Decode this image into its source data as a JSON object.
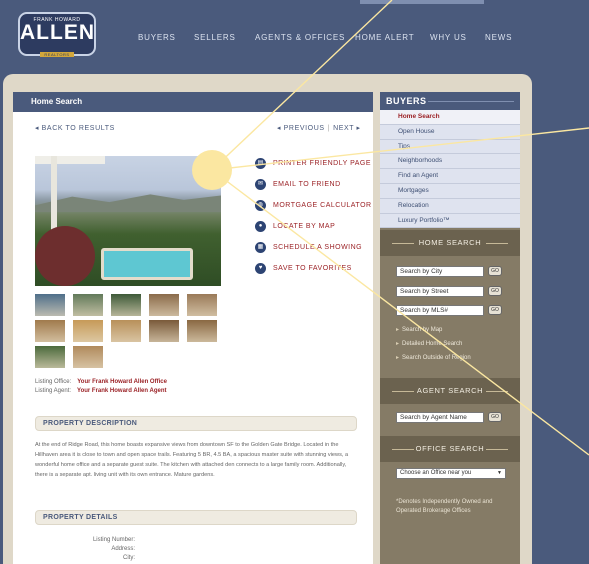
{
  "logo": {
    "top_text": "FRANK HOWARD",
    "name": "ALLEN",
    "sub_text": "REALTORS"
  },
  "nav": [
    "BUYERS",
    "SELLERS",
    "AGENTS & OFFICES",
    "HOME ALERT",
    "WHY US",
    "NEWS"
  ],
  "content": {
    "title": "Home Search",
    "back": "◂ BACK TO RESULTS",
    "previous": "◂ PREVIOUS",
    "separator": "|",
    "next": "NEXT ▸"
  },
  "actions": [
    {
      "label": "PRINTER FRIENDLY PAGE",
      "icon": "printer-icon",
      "glyph": "▤"
    },
    {
      "label": "EMAIL TO FRIEND",
      "icon": "envelope-icon",
      "glyph": "✉"
    },
    {
      "label": "MORTGAGE CALCULATOR",
      "icon": "globe-icon",
      "glyph": "◍"
    },
    {
      "label": "LOCATE BY MAP",
      "icon": "map-pin-icon",
      "glyph": "●"
    },
    {
      "label": "SCHEDULE A SHOWING",
      "icon": "calendar-icon",
      "glyph": "▦"
    },
    {
      "label": "SAVE TO FAVORITES",
      "icon": "heart-icon",
      "glyph": "♥"
    }
  ],
  "thumb_colors": [
    "#4f6f8a",
    "#627a5a",
    "#3e5a38",
    "#8b6b4a",
    "#9a7a58",
    "#a07a4c",
    "#c69a58",
    "#b8905a",
    "#7a5a3a",
    "#8a6842",
    "#4b6a3c",
    "#b08a5c"
  ],
  "agent": {
    "office_label": "Listing Office:",
    "office_value": "Your Frank Howard Allen Office",
    "agent_label": "Listing Agent:",
    "agent_value": "Your Frank Howard Allen Agent"
  },
  "description": {
    "heading": "PROPERTY DESCRIPTION",
    "text": "At the end of Ridge Road, this home boasts expansive views from downtown SF to the Golden Gate Bridge. Located in the Hillhaven area it is close to town and open space trails. Featuring 5 BR, 4.5 BA, a spacious master suite with stunning views, a wonderful home office and a separate guest suite. The kitchen with attached den connects to a large family room. Additionally, there is a separate apt. living unit with its own entrance. Mature gardens."
  },
  "details": {
    "heading": "PROPERTY DETAILS",
    "labels": [
      "Listing Number:",
      "Address:",
      "City:"
    ]
  },
  "sidebar": {
    "heading": "BUYERS",
    "menu": [
      "Home Search",
      "Open House",
      "Tips",
      "Neighborhoods",
      "Find an Agent",
      "Mortgages",
      "Relocation",
      "Luxury Portfolio™"
    ],
    "home_search": {
      "heading": "HOME SEARCH",
      "inputs": [
        "Search by City",
        "Search by Street",
        "Search by MLS#"
      ],
      "go": "GO",
      "links": [
        "Search by Map",
        "Detailed Home Search",
        "Search Outside of Region"
      ]
    },
    "agent_search": {
      "heading": "AGENT SEARCH",
      "input": "Search by Agent Name"
    },
    "office_search": {
      "heading": "OFFICE SEARCH",
      "select": "Choose an Office near you",
      "note": "*Denotes Independently Owned and Operated Brokerage Offices"
    }
  },
  "colors": {
    "navy": "#4a5a7c",
    "accent_red": "#9b2226",
    "sidebar_tan": "#857b66",
    "highlight": "#fbe7a1"
  }
}
